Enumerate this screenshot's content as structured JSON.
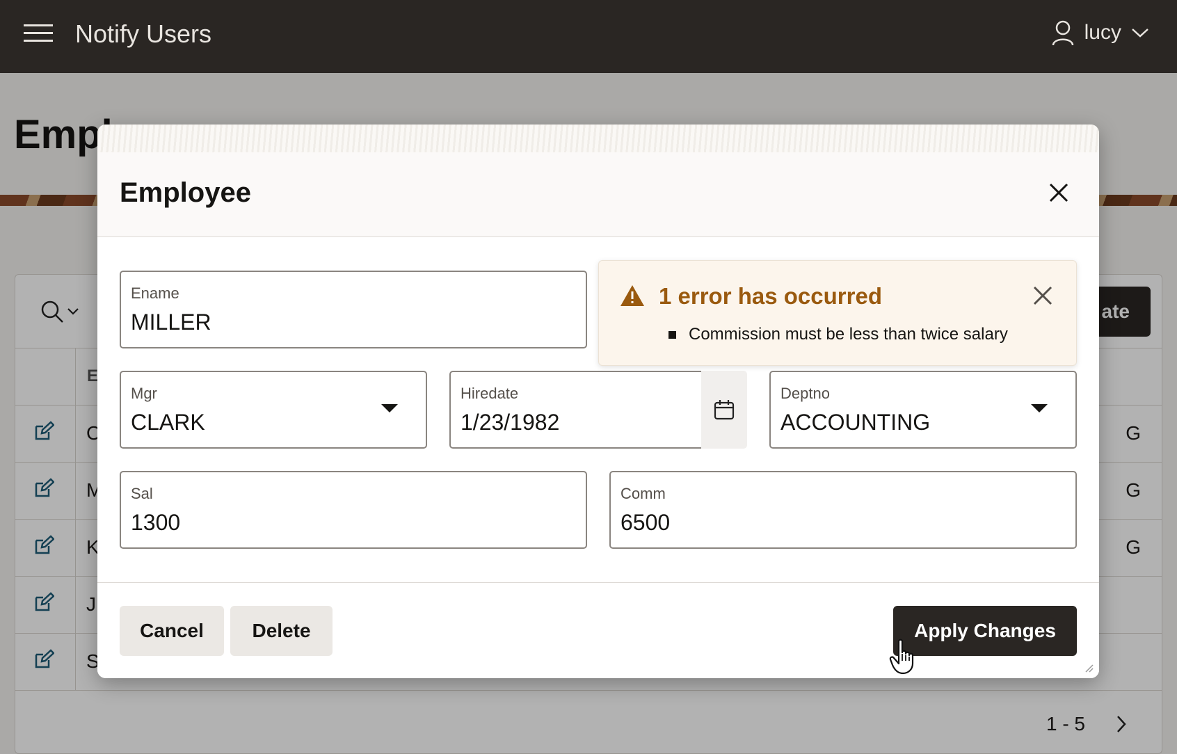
{
  "header": {
    "app_title": "Notify Users",
    "user_name": "lucy"
  },
  "page": {
    "title": "Empl",
    "create_label": "ate",
    "report_col_partial": "E",
    "rows": [
      {
        "name_partial": "C",
        "tail": "G"
      },
      {
        "name_partial": "M",
        "tail": "G"
      },
      {
        "name_partial": "K",
        "tail": "G"
      },
      {
        "name_partial": "J",
        "tail": ""
      },
      {
        "name_partial": "S",
        "tail": ""
      }
    ],
    "pagination": "1 - 5"
  },
  "dialog": {
    "title": "Employee",
    "fields": {
      "ename": {
        "label": "Ename",
        "value": "MILLER"
      },
      "mgr": {
        "label": "Mgr",
        "value": "CLARK"
      },
      "hiredate": {
        "label": "Hiredate",
        "value": "1/23/1982"
      },
      "deptno": {
        "label": "Deptno",
        "value": "ACCOUNTING"
      },
      "sal": {
        "label": "Sal",
        "value": "1300"
      },
      "comm": {
        "label": "Comm",
        "value": "6500"
      }
    },
    "error": {
      "title": "1 error has occurred",
      "items": [
        "Commission must be less than twice salary"
      ]
    },
    "buttons": {
      "cancel": "Cancel",
      "delete": "Delete",
      "apply": "Apply Changes"
    }
  },
  "colors": {
    "header_bg": "#2a2623",
    "primary_button": "#2a2623",
    "error_text": "#9a5a0f",
    "error_bg": "#fcf5ec"
  },
  "icons": [
    "menu-icon",
    "user-icon",
    "chevron-down-icon",
    "search-icon",
    "edit-icon",
    "close-icon",
    "warning-icon",
    "calendar-icon",
    "chevron-right-icon",
    "hand-cursor-icon"
  ]
}
